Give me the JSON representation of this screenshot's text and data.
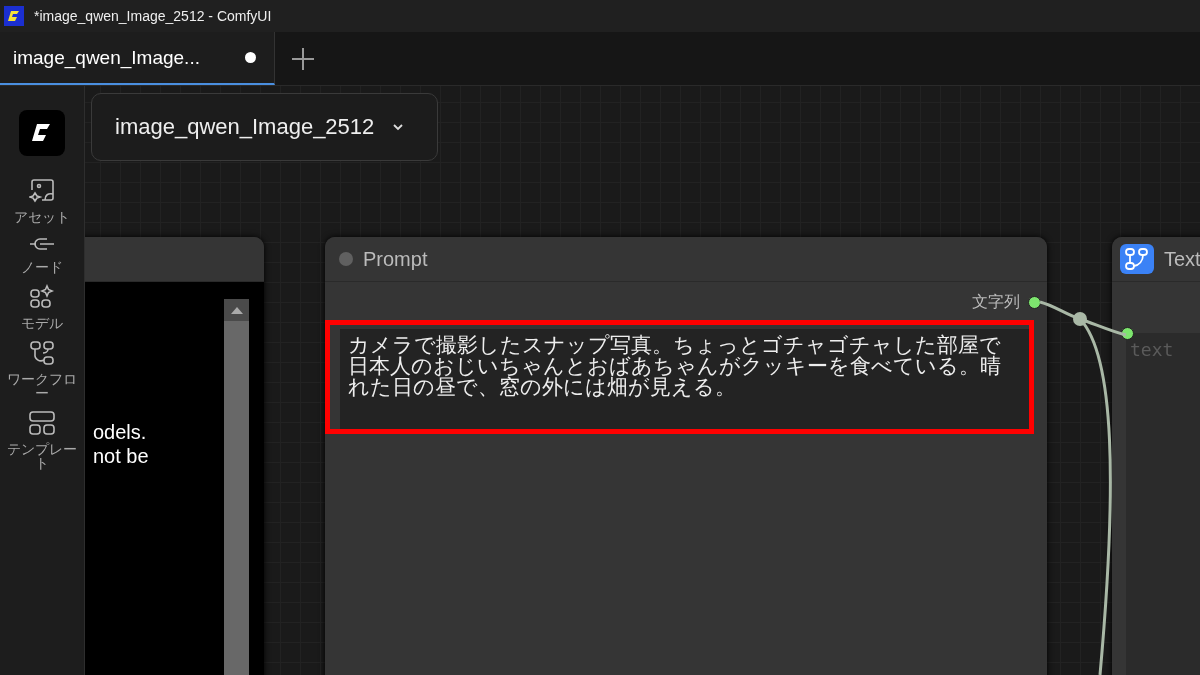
{
  "window": {
    "title": "*image_qwen_Image_2512 - ComfyUI"
  },
  "tabs": [
    {
      "label": "image_qwen_Image...",
      "selected": true,
      "modified": true
    }
  ],
  "workflow_selector": {
    "label": "image_qwen_Image_2512"
  },
  "sidebar": {
    "items": [
      {
        "kind": "assets",
        "label": "アセット"
      },
      {
        "kind": "nodes",
        "label": "ノード"
      },
      {
        "kind": "models",
        "label": "モデル"
      },
      {
        "kind": "workflows",
        "label": "ワークフロー"
      },
      {
        "kind": "templates",
        "label": "テンプレート"
      }
    ]
  },
  "nodes": [
    {
      "kind": "display",
      "lines": [
        "odels.",
        "not be"
      ]
    },
    {
      "kind": "prompt",
      "title": "Prompt",
      "output": "文字列",
      "value": "カメラで撮影したスナップ写真。ちょっとゴチャゴチャした部屋で日本人のおじいちゃんとおばあちゃんがクッキーを食べている。晴れた日の昼で、窓の外には畑が見える。",
      "highlighted": true
    },
    {
      "kind": "text_input",
      "title": "Text",
      "placeholder": "text"
    }
  ]
}
